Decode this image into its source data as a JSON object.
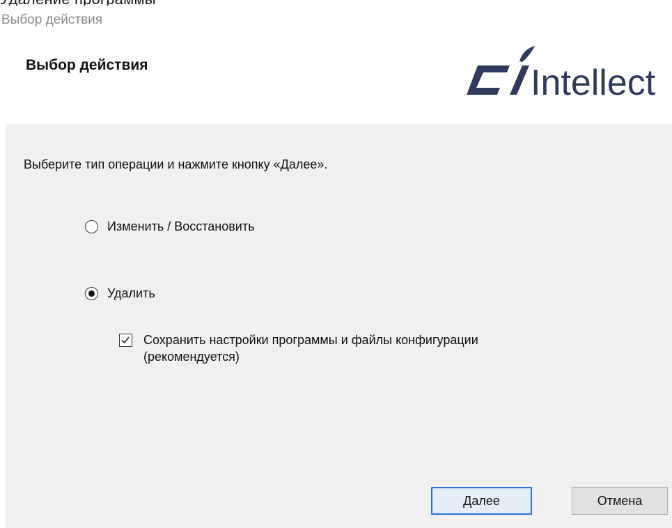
{
  "window": {
    "title": "Удаление программы",
    "caption": "Выбор действия"
  },
  "header": {
    "title": "Выбор действия",
    "logo_text": "Intellect",
    "logo_color": "#2f3a5c"
  },
  "main": {
    "instruction": "Выберите тип операции и нажмите кнопку «Далее».",
    "options": [
      {
        "label": "Изменить / Восстановить",
        "selected": false
      },
      {
        "label": "Удалить",
        "selected": true
      }
    ],
    "keep_settings": {
      "label": "Сохранить настройки программы и файлы конфигурации (рекомендуется)",
      "checked": true
    }
  },
  "buttons": {
    "next_label": "Далее",
    "cancel_label": "Отмена"
  },
  "colors": {
    "panel_bg": "#f0f0f0",
    "default_button_border": "#2a73d8"
  }
}
